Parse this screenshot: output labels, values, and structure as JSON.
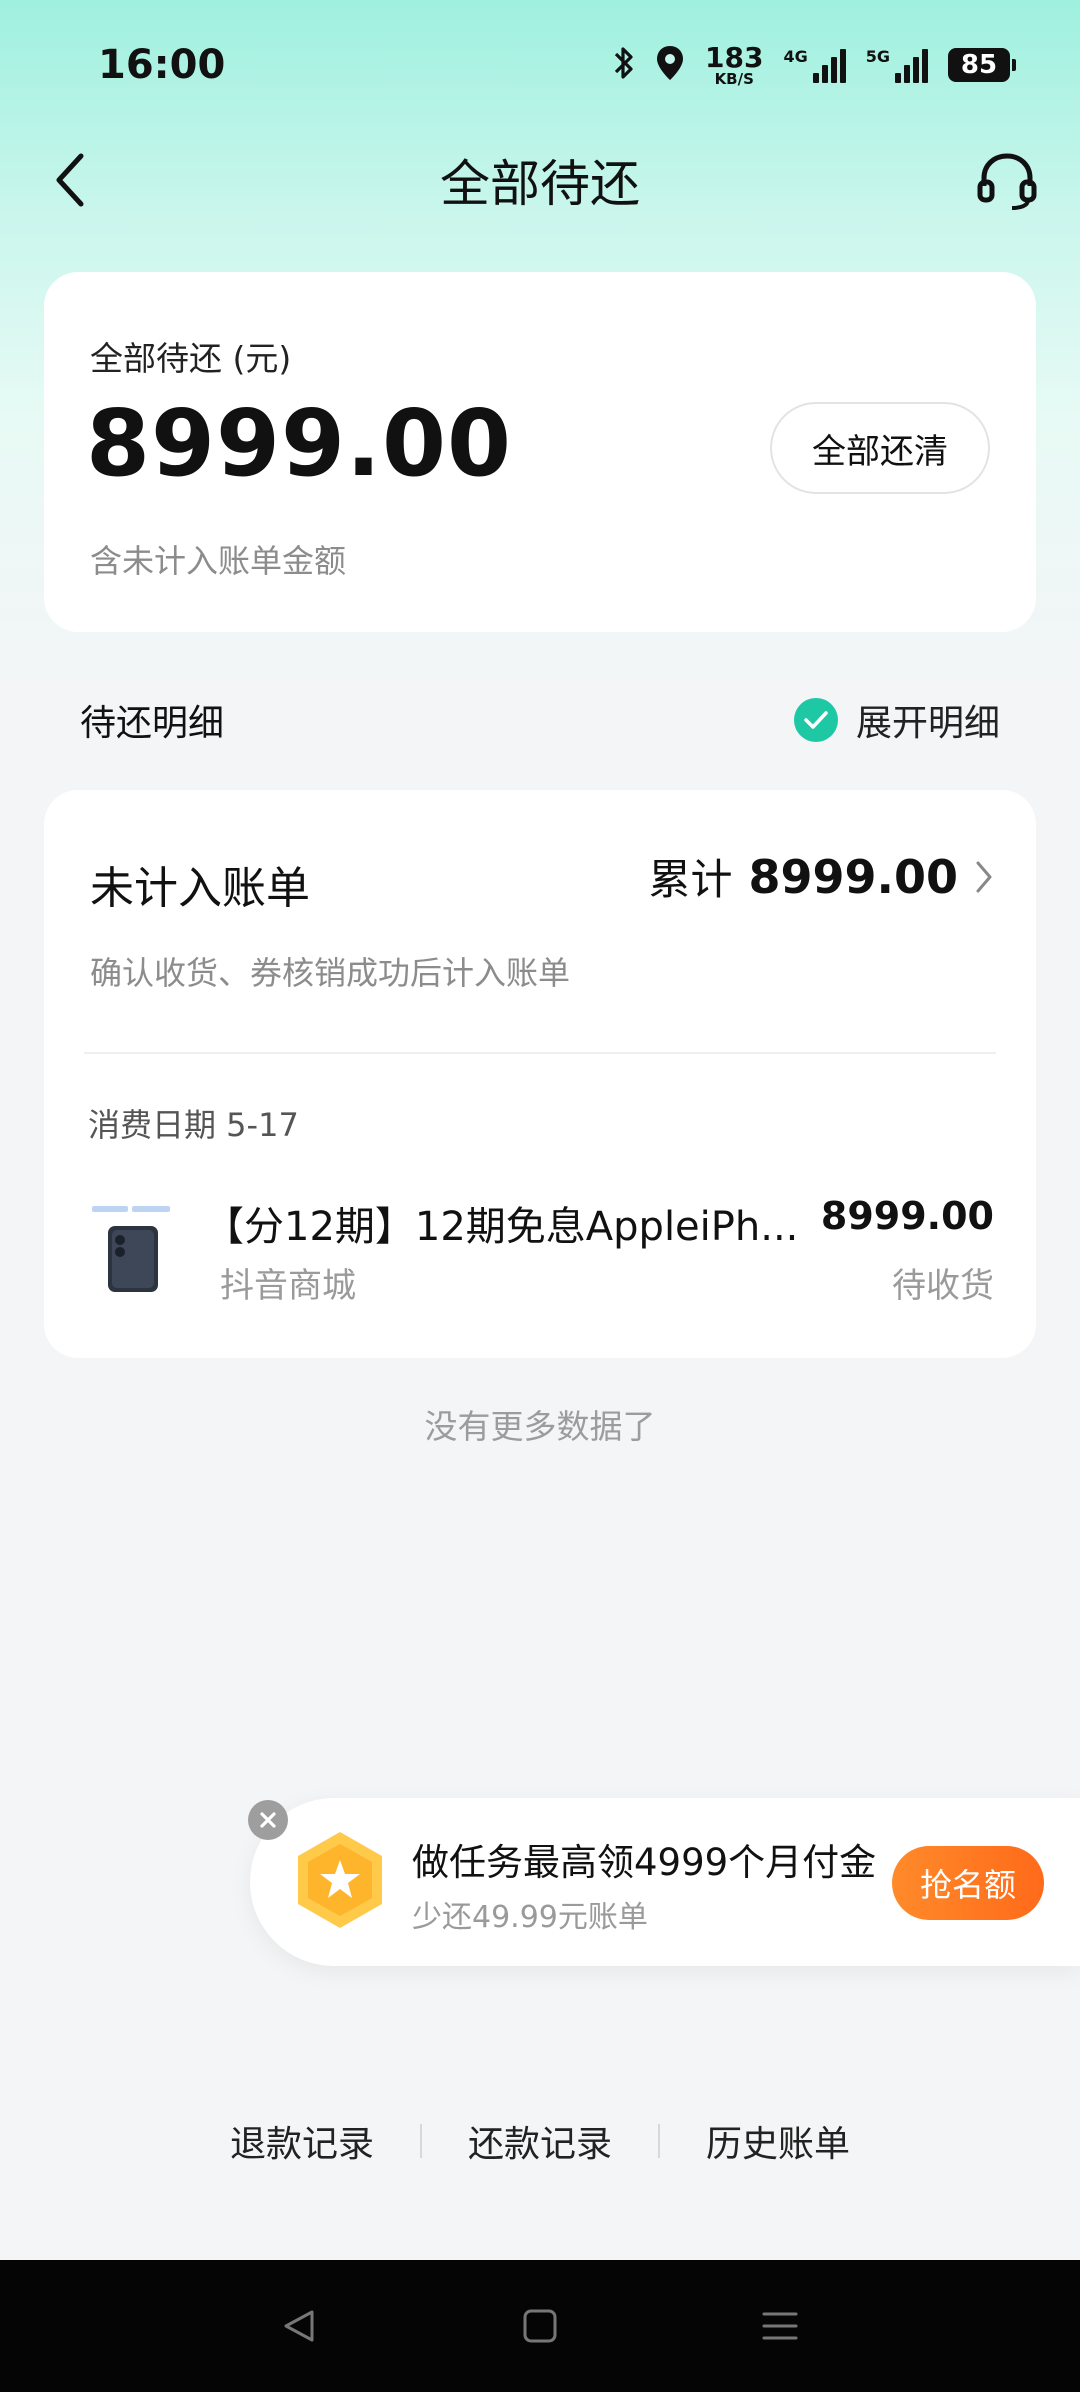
{
  "status_bar": {
    "time": "16:00",
    "net_speed_value": "183",
    "net_speed_unit": "KB/S",
    "signal1_label": "4G",
    "signal2_label": "5G",
    "battery": "85"
  },
  "nav": {
    "title": "全部待还"
  },
  "summary": {
    "label": "全部待还 (元)",
    "amount": "8999.00",
    "note": "含未计入账单金额",
    "pay_all_label": "全部还清"
  },
  "section": {
    "title": "待还明细",
    "expand_label": "展开明细",
    "expand_checked": true
  },
  "unbilled": {
    "title": "未计入账单",
    "total_label": "累计",
    "total_value": "8999.00",
    "note": "确认收货、券核销成功后计入账单",
    "date_label": "消费日期 5-17",
    "order": {
      "title": "【分12期】12期免息AppleiPh...",
      "merchant": "抖音商城",
      "amount": "8999.00",
      "status": "待收货"
    }
  },
  "list_end": "没有更多数据了",
  "promo": {
    "title": "做任务最高领4999个月付金",
    "subtitle": "少还49.99元账单",
    "button": "抢名额"
  },
  "bottom_links": {
    "refund": "退款记录",
    "repayment": "还款记录",
    "history": "历史账单"
  },
  "colors": {
    "accent": "#1ec8a5",
    "promo_button": "#ff7a22",
    "background": "#f4f5f7"
  }
}
